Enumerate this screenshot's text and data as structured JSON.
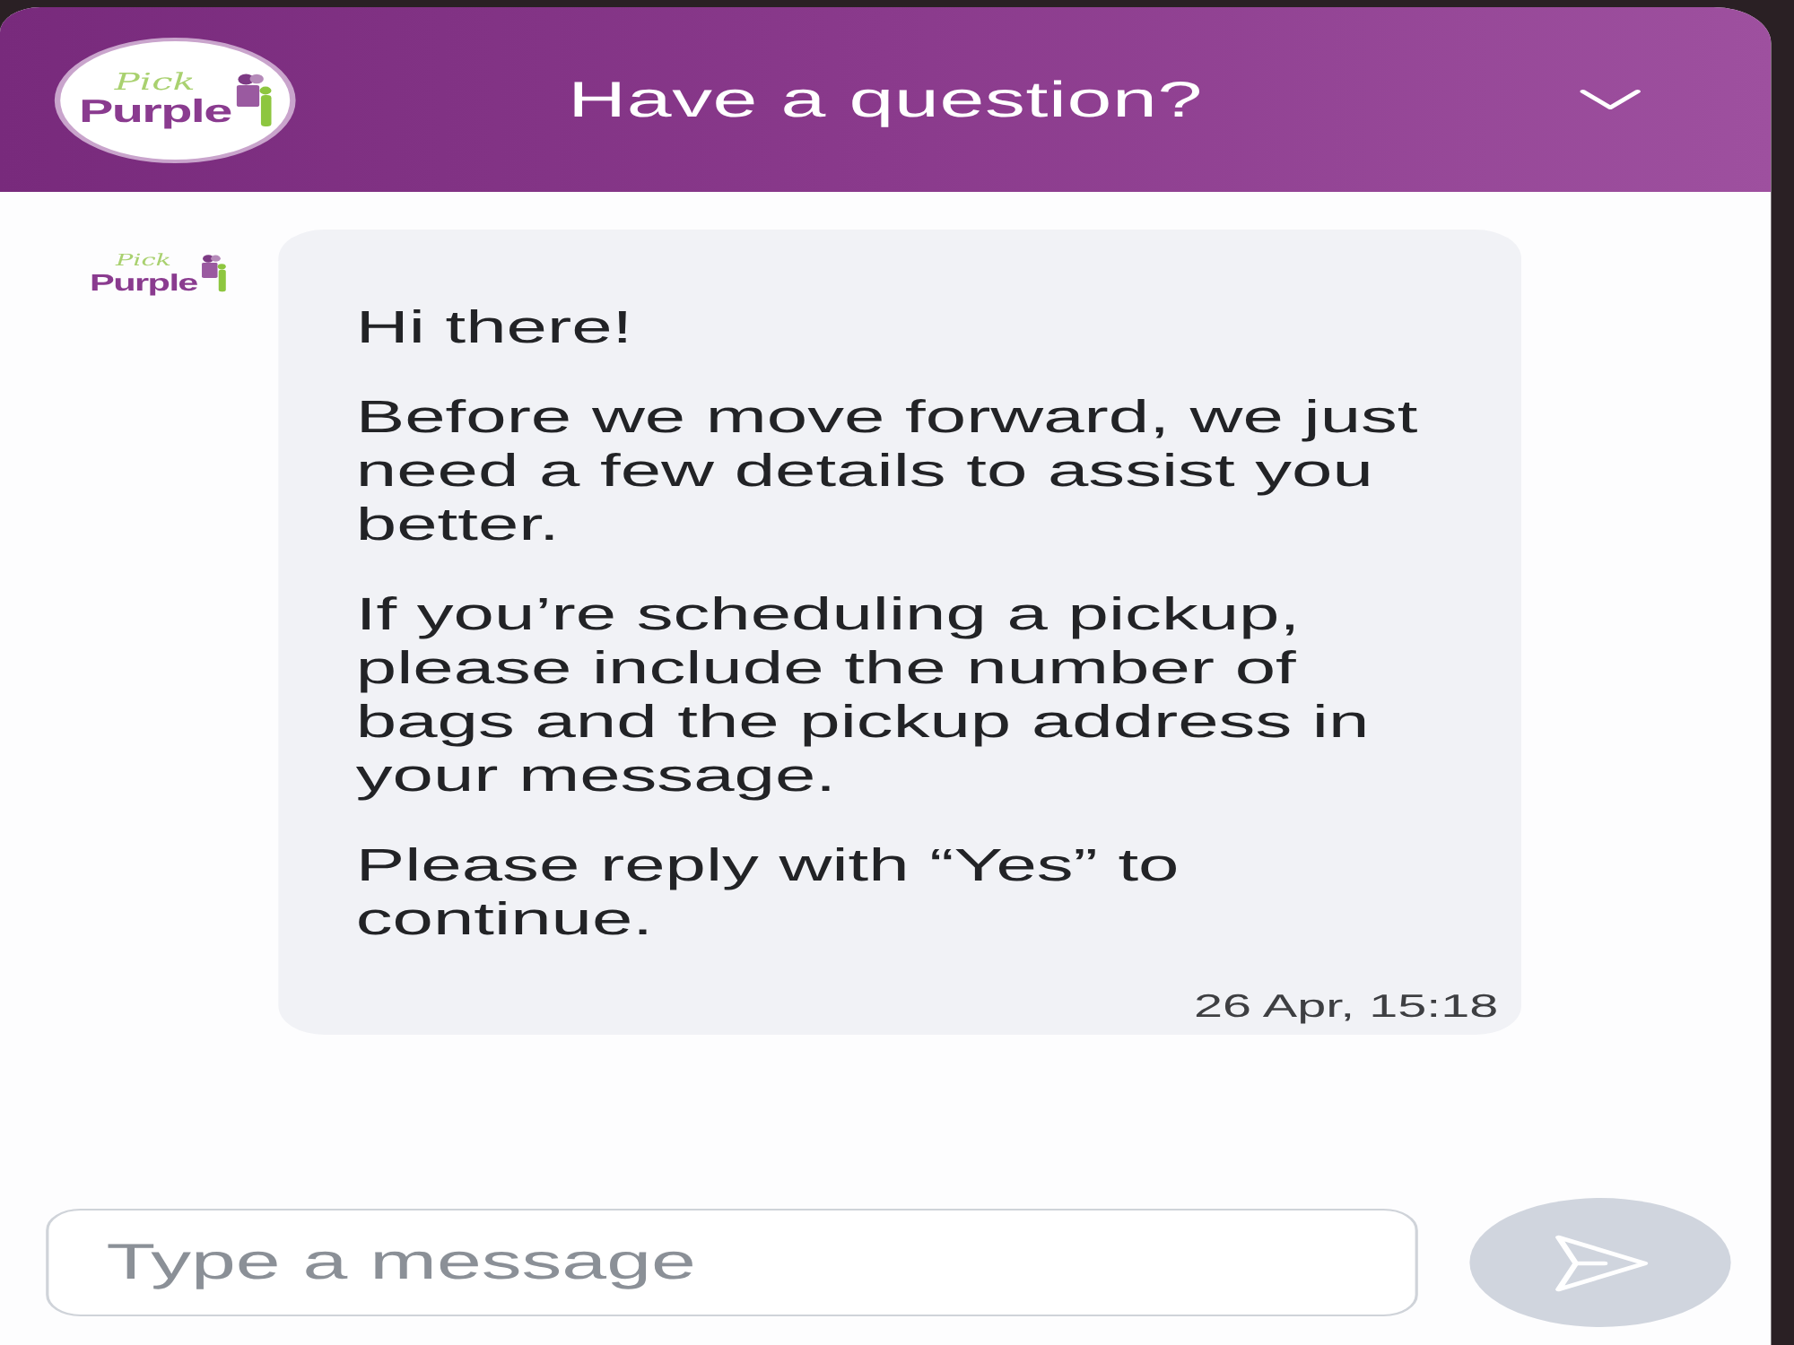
{
  "header": {
    "logo": {
      "top_word": "Pick",
      "bottom_word": "Purple"
    },
    "title": "Have a question?"
  },
  "messages": [
    {
      "sender_logo": {
        "top_word": "Pick",
        "bottom_word": "Purple"
      },
      "paragraphs": [
        "Hi there!",
        "Before we move forward, we just need a few details to assist you better.",
        "If you’re scheduling a pickup, please include the number of bags and the pickup address in your message.",
        "Please reply with “Yes” to continue."
      ],
      "time": "26 Apr, 15:18"
    }
  ],
  "composer": {
    "placeholder": "Type a message",
    "send_button": {
      "disabled": true
    }
  }
}
